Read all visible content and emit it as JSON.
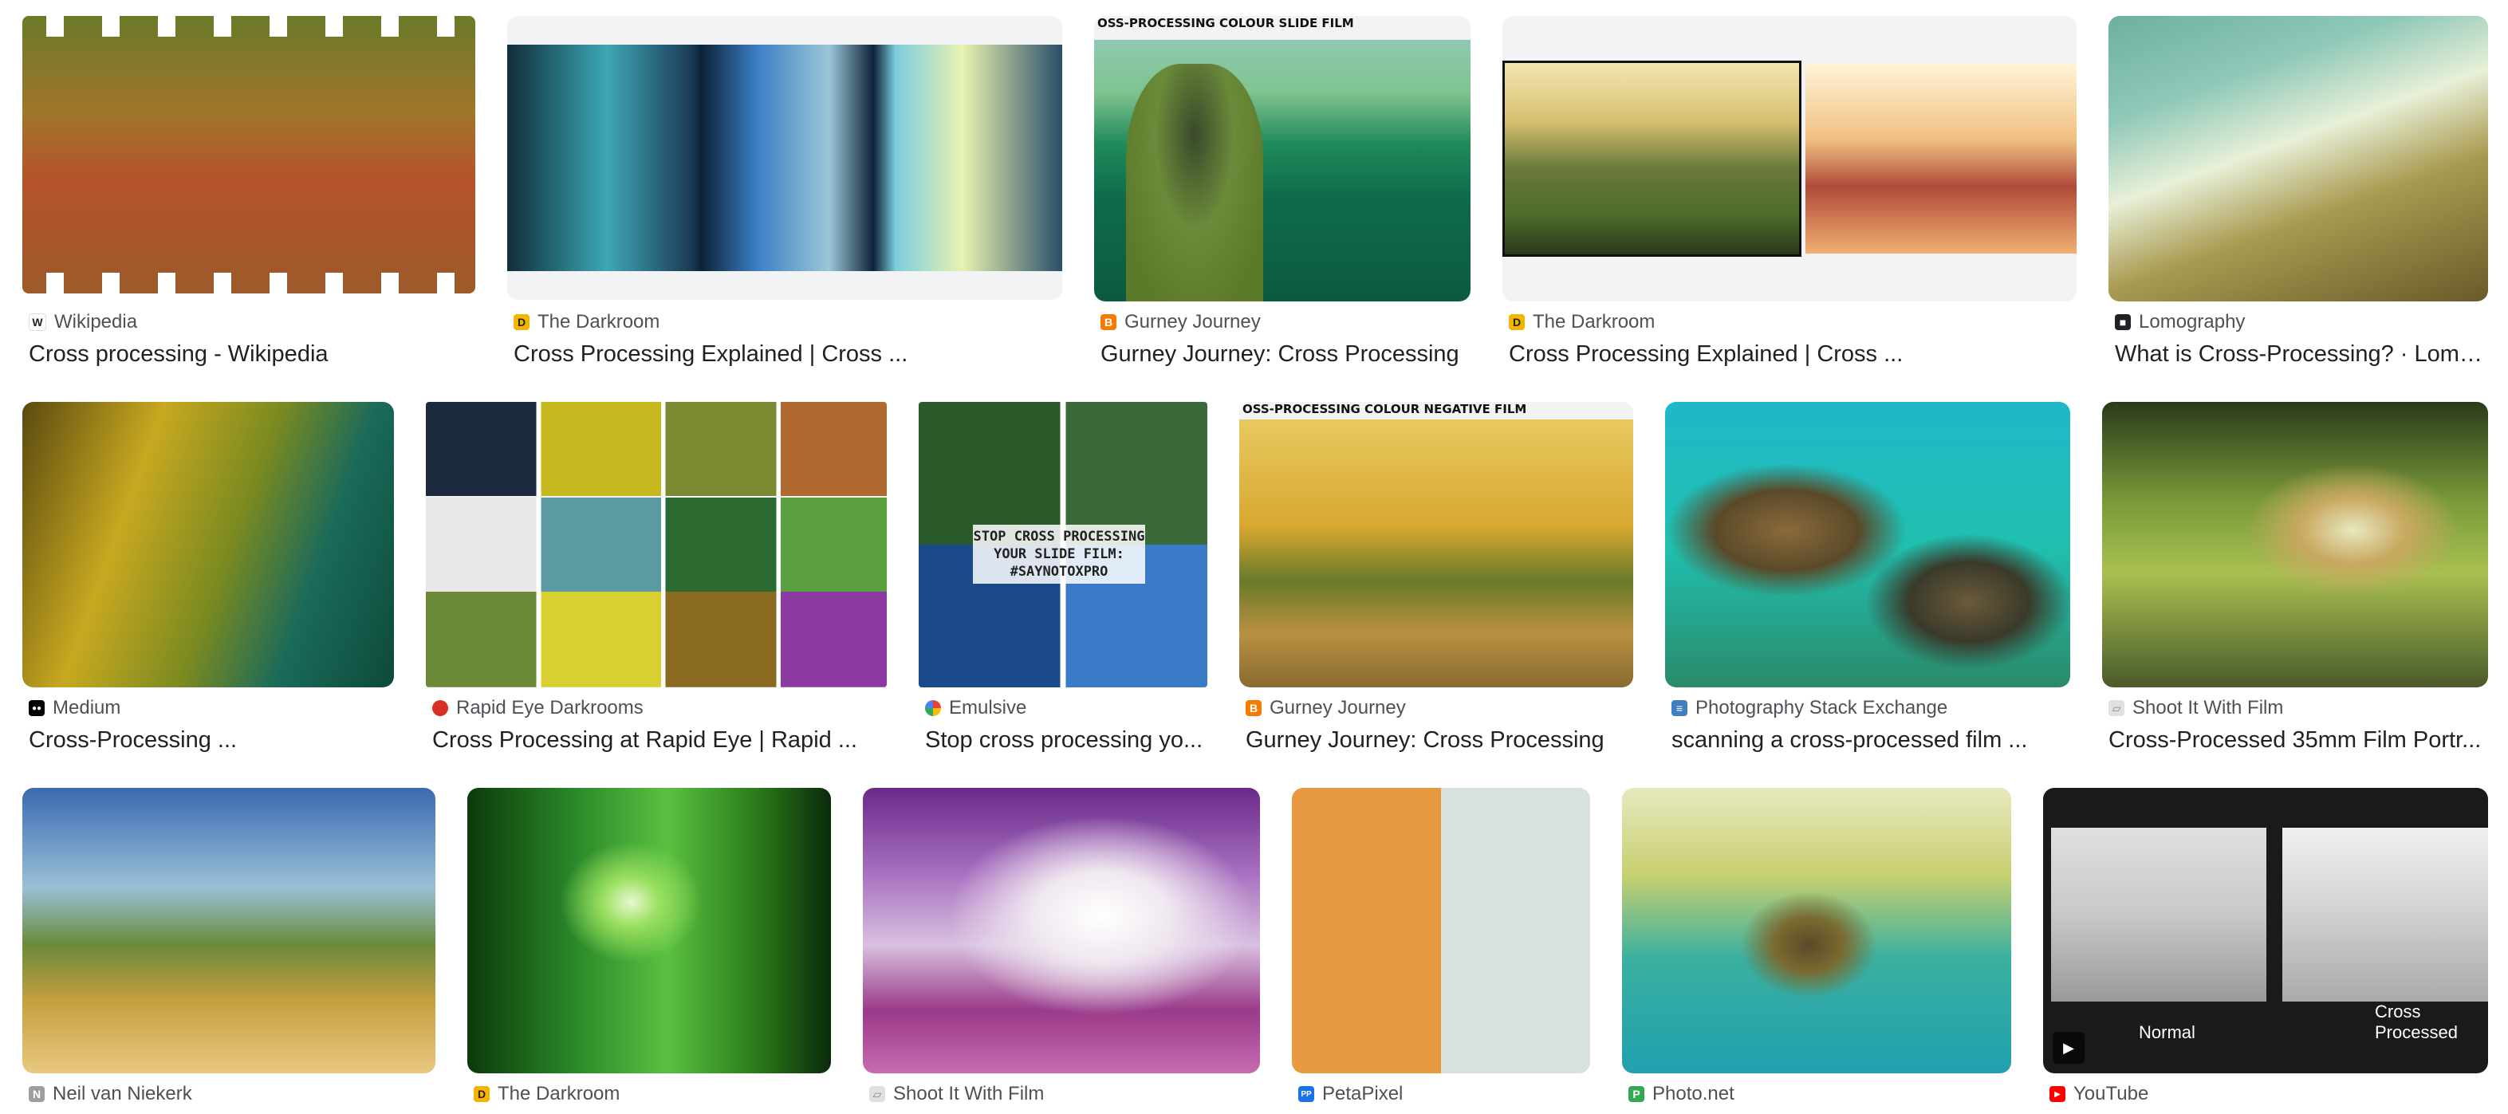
{
  "results": [
    {
      "source": "Wikipedia",
      "title": "Cross processing - Wikipedia",
      "fav_glyph": "W",
      "fav_color": "#ffffff",
      "fav_fg": "#202124"
    },
    {
      "source": "The Darkroom",
      "title": "Cross Processing Explained | Cross ...",
      "fav_glyph": "D",
      "fav_color": "#f4b400",
      "fav_fg": "#222222"
    },
    {
      "source": "Gurney Journey",
      "title": "Gurney Journey: Cross Processing",
      "fav_glyph": "B",
      "fav_color": "#f57c00",
      "fav_fg": "#ffffff",
      "overlay": "OSS-PROCESSING COLOUR SLIDE FILM"
    },
    {
      "source": "The Darkroom",
      "title": "Cross Processing Explained | Cross ...",
      "fav_glyph": "D",
      "fav_color": "#f4b400",
      "fav_fg": "#222222"
    },
    {
      "source": "Lomography",
      "title": "What is Cross-Processing? · Lomo...",
      "fav_glyph": "■",
      "fav_color": "#202124",
      "fav_fg": "#ffffff"
    },
    {
      "source": "Medium",
      "title": "Cross-Processing ...",
      "fav_glyph": "●●",
      "fav_color": "#000000",
      "fav_fg": "#ffffff"
    },
    {
      "source": "Rapid Eye Darkrooms",
      "title": "Cross Processing at Rapid Eye | Rapid ...",
      "fav_glyph": "",
      "fav_color": "#d93025",
      "fav_fg": "#ffffff"
    },
    {
      "source": "Emulsive",
      "title": "Stop cross processing yo...",
      "fav_glyph": "",
      "fav_color": "#4285f4",
      "fav_fg": "#ffffff",
      "overlay_lines": [
        "STOP CROSS PROCESSING",
        "YOUR SLIDE FILM:",
        "#SAYNOTOXPRO"
      ]
    },
    {
      "source": "Gurney Journey",
      "title": "Gurney Journey: Cross Processing",
      "fav_glyph": "B",
      "fav_color": "#f57c00",
      "fav_fg": "#ffffff",
      "overlay": "OSS-PROCESSING COLOUR NEGATIVE FILM"
    },
    {
      "source": "Photography Stack Exchange",
      "title": "scanning a cross-processed film ...",
      "fav_glyph": "≡",
      "fav_color": "#3f7fbf",
      "fav_fg": "#ffffff"
    },
    {
      "source": "Shoot It With Film",
      "title": "Cross-Processed 35mm Film Portr...",
      "fav_glyph": "▱",
      "fav_color": "#bdbdbd",
      "fav_fg": "#ffffff"
    },
    {
      "source": "Neil van Niekerk",
      "title": "",
      "fav_glyph": "N",
      "fav_color": "#9e9e9e",
      "fav_fg": "#ffffff"
    },
    {
      "source": "The Darkroom",
      "title": "",
      "fav_glyph": "D",
      "fav_color": "#f4b400",
      "fav_fg": "#222222"
    },
    {
      "source": "Shoot It With Film",
      "title": "",
      "fav_glyph": "▱",
      "fav_color": "#bdbdbd",
      "fav_fg": "#ffffff"
    },
    {
      "source": "PetaPixel",
      "title": "",
      "fav_glyph": "PP",
      "fav_color": "#1a73e8",
      "fav_fg": "#ffffff"
    },
    {
      "source": "Photo.net",
      "title": "",
      "fav_glyph": "P",
      "fav_color": "#34a853",
      "fav_fg": "#ffffff"
    },
    {
      "source": "YouTube",
      "title": "",
      "fav_glyph": "▶",
      "fav_color": "#ff0000",
      "fav_fg": "#ffffff",
      "caption_left": "Normal",
      "caption_right": "Cross Processed"
    }
  ]
}
